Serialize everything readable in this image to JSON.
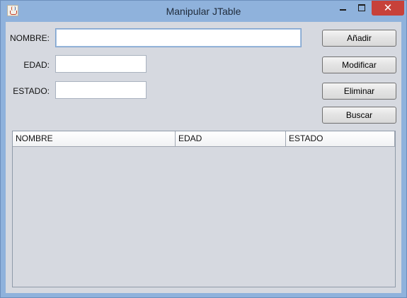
{
  "window": {
    "title": "Manipular JTable",
    "icon": "java-icon",
    "controls": {
      "minimize": "minimize-icon",
      "maximize": "maximize-icon",
      "close": "✕"
    },
    "colors": {
      "frame": "#8fb2dc",
      "panel": "#d6d9e0",
      "close": "#c7413a"
    }
  },
  "form": {
    "nombre": {
      "label": "NOMBRE:",
      "value": ""
    },
    "edad": {
      "label": "EDAD:",
      "value": ""
    },
    "estado": {
      "label": "ESTADO:",
      "value": ""
    }
  },
  "buttons": {
    "anadir": "Añadir",
    "modificar": "Modificar",
    "eliminar": "Eliminar",
    "buscar": "Buscar"
  },
  "table": {
    "columns": [
      "NOMBRE",
      "EDAD",
      "ESTADO"
    ],
    "rows": []
  }
}
